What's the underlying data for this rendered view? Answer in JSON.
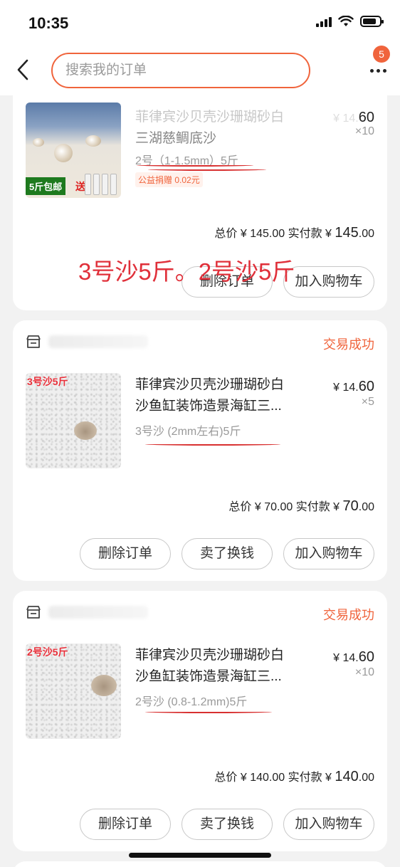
{
  "status_bar": {
    "time": "10:35"
  },
  "nav": {
    "search_placeholder": "搜索我的订单",
    "badge_count": "5"
  },
  "orders": [
    {
      "title_line1": "菲律宾沙贝壳沙珊瑚砂白",
      "title_line2": "三湖慈鲷底沙",
      "spec": "2号（1-1.5mm）5斤",
      "price_prefix": "¥ 14.",
      "price_suffix": "60",
      "qty": "×10",
      "donation": "公益捐赠 0.02元",
      "total_label": "总价 ¥ 145.00 实付款 ¥ ",
      "paid_int": "145",
      "paid_dec": ".00",
      "thumb_label": "5斤包邮",
      "thumb_gift": "送",
      "buttons": [
        "删除订单",
        "加入购物车"
      ]
    },
    {
      "status": "交易成功",
      "title_line1": "菲律宾沙贝壳沙珊瑚砂白",
      "title_line2": "沙鱼缸装饰造景海缸三...",
      "spec": "3号沙 (2mm左右)5斤",
      "price_prefix": "¥ 14.",
      "price_suffix": "60",
      "qty": "×5",
      "total_label": "总价 ¥ 70.00 实付款 ¥ ",
      "paid_int": "70",
      "paid_dec": ".00",
      "thumb_tag": "3号沙5斤",
      "buttons": [
        "删除订单",
        "卖了换钱",
        "加入购物车"
      ]
    },
    {
      "status": "交易成功",
      "title_line1": "菲律宾沙贝壳沙珊瑚砂白",
      "title_line2": "沙鱼缸装饰造景海缸三...",
      "spec": "2号沙 (0.8-1.2mm)5斤",
      "price_prefix": "¥ 14.",
      "price_suffix": "60",
      "qty": "×10",
      "total_label": "总价 ¥ 140.00 实付款 ¥ ",
      "paid_int": "140",
      "paid_dec": ".00",
      "thumb_tag": "2号沙5斤",
      "buttons": [
        "删除订单",
        "卖了换钱",
        "加入购物车"
      ]
    }
  ],
  "annotation": "3号沙5斤。2号沙5斤",
  "colors": {
    "accent": "#f0643c",
    "note_red": "#e0303a"
  }
}
